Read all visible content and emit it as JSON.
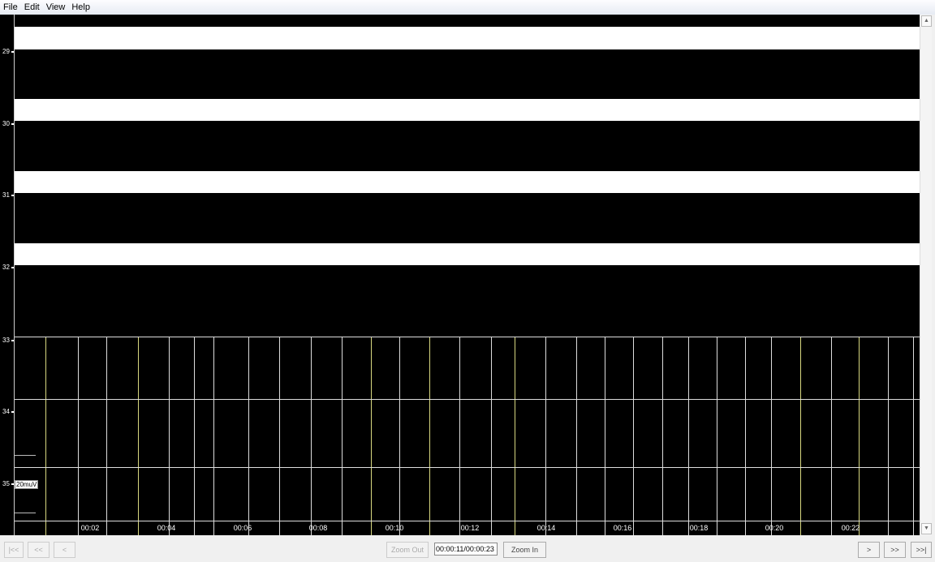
{
  "menu": [
    "File",
    "Edit",
    "View",
    "Help"
  ],
  "channels": [
    "29",
    "30",
    "31",
    "32",
    "33",
    "34",
    "35"
  ],
  "scale_label": "20muV",
  "time_labels": [
    "00:02",
    "00:04",
    "00:06",
    "00:08",
    "00:10",
    "00:12",
    "00:14",
    "00:16",
    "00:18",
    "00:20",
    "00:22"
  ],
  "toolbar": {
    "first": "|<<",
    "prev_page": "<<",
    "prev": "<",
    "zoom_out": "Zoom Out",
    "time_value": "00:00:11/00:00:23",
    "zoom_in": "Zoom In",
    "next": ">",
    "next_page": ">>",
    "last": ">>|"
  },
  "colors": {
    "background": "#000000",
    "grid": "#dddddd",
    "marker": "#d8d880"
  }
}
